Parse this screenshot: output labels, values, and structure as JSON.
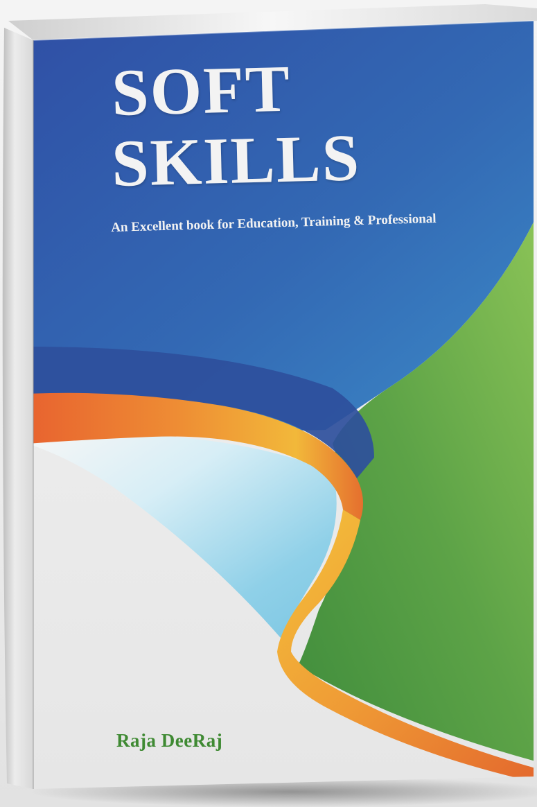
{
  "cover": {
    "title_line1": "SOFT",
    "title_line2": "SKILLS",
    "subtitle": "An Excellent book for Education, Training & Professional",
    "author": "Raja DeeRaj"
  },
  "colors": {
    "blue_top": "#2f55a8",
    "blue_mid": "#3a7fc0",
    "green": "#4f9a45",
    "orange": "#e8772f",
    "yellow": "#f0b834",
    "sky": "#9dd6ea",
    "author_green": "#3f8a33"
  }
}
